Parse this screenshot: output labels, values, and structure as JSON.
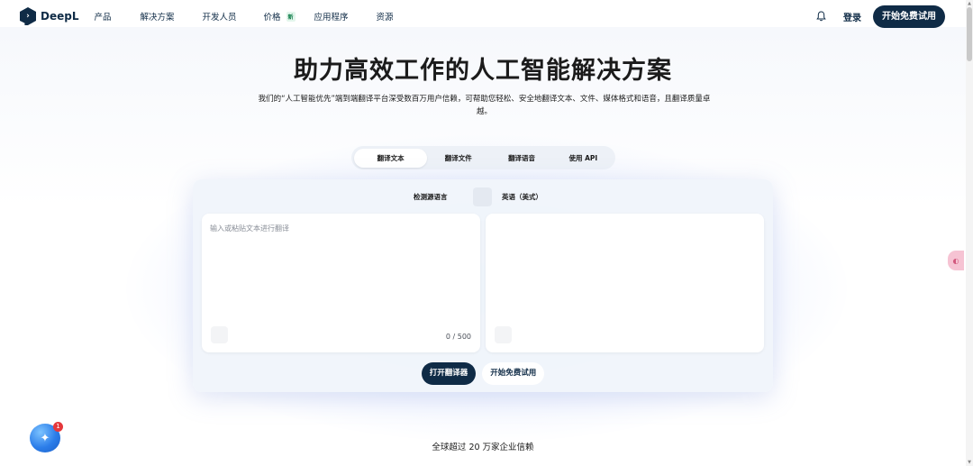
{
  "nav": {
    "brand": "DeepL",
    "links": [
      {
        "label": "产品"
      },
      {
        "label": "解决方案"
      },
      {
        "label": "开发人员"
      },
      {
        "label": "价格",
        "badge": "新"
      },
      {
        "label": "应用程序"
      },
      {
        "label": "资源"
      }
    ],
    "bell_icon": "bell-icon",
    "login_label": "登录",
    "trial_label": "开始免费试用"
  },
  "hero": {
    "title": "助力高效工作的人工智能解决方案",
    "subtitle": "我们的“人工智能优先”端到端翻译平台深受数百万用户信赖，可帮助您轻松、安全地翻译文本、文件、媒体格式和语音，且翻译质量卓越。"
  },
  "tabs": [
    {
      "label": "翻译文本",
      "active": true
    },
    {
      "label": "翻译文件",
      "active": false
    },
    {
      "label": "翻译语音",
      "active": false
    },
    {
      "label": "使用 API",
      "active": false
    }
  ],
  "translator": {
    "source_lang": "检测源语言",
    "swap_icon": "swap-icon",
    "target_lang": "英语（美式）",
    "input_placeholder": "输入或粘贴文本进行翻译",
    "counter": "0 / 500",
    "mic_icon": "microphone-icon",
    "copy_icon": "copy-icon",
    "open_label": "打开翻译器",
    "trial_label": "开始免费试用"
  },
  "trust_text": "全球超过 20 万家企业信赖",
  "widgets": {
    "bot_icon": "chat-bot-icon",
    "bot_badge": "1",
    "side_icon": "side-assistant-icon"
  },
  "colors": {
    "brand": "#0f2b46",
    "badge_new_bg": "#e3f6ec",
    "notification": "#e5383b"
  }
}
